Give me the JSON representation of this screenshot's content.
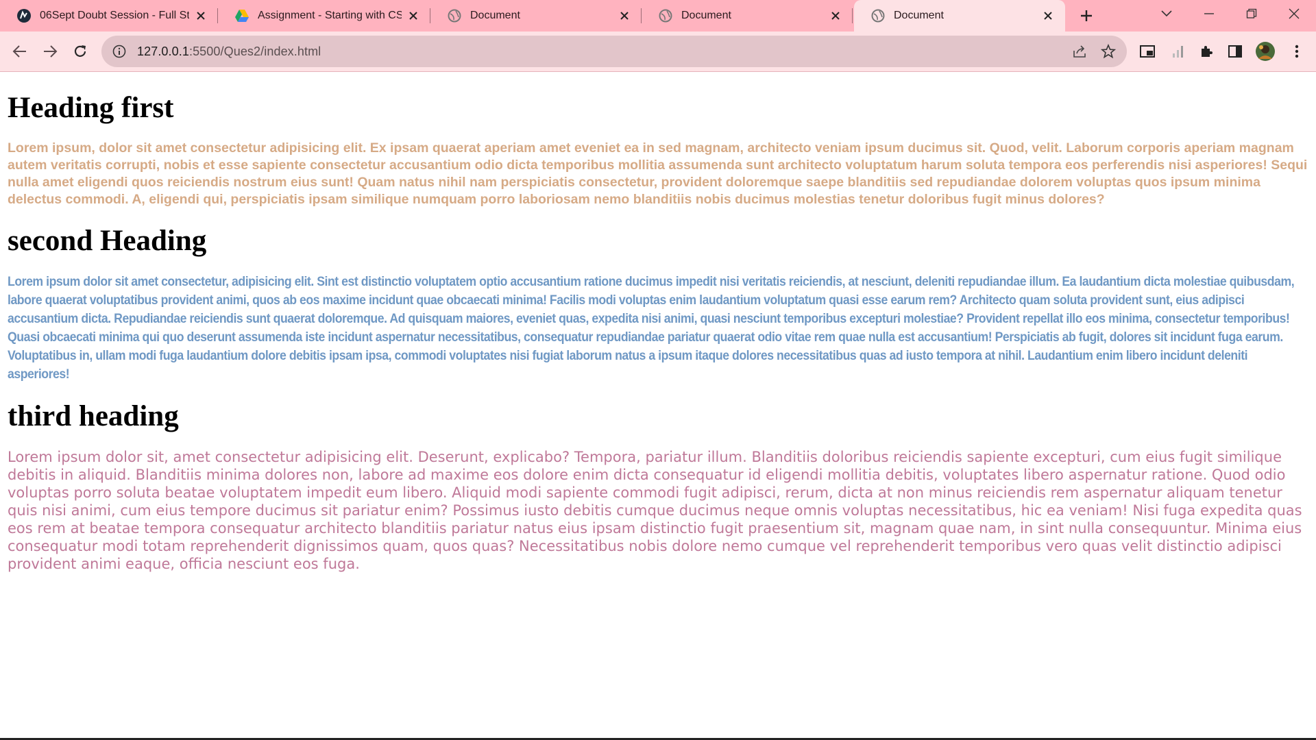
{
  "browser": {
    "tabs": [
      {
        "title": "06Sept Doubt Session - Full St",
        "favicon": "site-logo-icon",
        "active": false
      },
      {
        "title": "Assignment - Starting with CS",
        "favicon": "google-drive-icon",
        "active": false
      },
      {
        "title": "Document",
        "favicon": "globe-icon",
        "active": false
      },
      {
        "title": "Document",
        "favicon": "globe-icon",
        "active": false
      },
      {
        "title": "Document",
        "favicon": "globe-icon",
        "active": true
      }
    ],
    "address": {
      "host": "127.0.0.1",
      "path": ":5500/Ques2/index.html"
    },
    "colors": {
      "tabstrip": "#ffb3bf",
      "toolbar": "#fde2e5",
      "omnibox": "#e2c5ca"
    }
  },
  "page": {
    "sections": [
      {
        "heading": "Heading first",
        "paragraph": "Lorem ipsum, dolor sit amet consectetur adipisicing elit. Ex ipsam quaerat aperiam amet eveniet ea in sed magnam, architecto veniam ipsum ducimus sit. Quod, velit. Laborum corporis aperiam magnam autem veritatis corrupti, nobis et esse sapiente consectetur accusantium odio dicta temporibus mollitia assumenda sunt architecto voluptatum harum soluta tempora eos perferendis nisi asperiores! Sequi nulla amet eligendi quos reiciendis nostrum eius sunt! Quam natus nihil nam perspiciatis consectetur, provident doloremque saepe blanditiis sed repudiandae dolorem voluptas quos ipsum minima delectus commodi. A, eligendi qui, perspiciatis ipsam similique numquam porro laboriosam nemo blanditiis nobis ducimus molestias tenetur doloribus fugit minus dolores?",
        "color": "#d6aa86"
      },
      {
        "heading": "second Heading",
        "paragraph": "Lorem ipsum dolor sit amet consectetur, adipisicing elit. Sint est distinctio voluptatem optio accusantium ratione ducimus impedit nisi veritatis reiciendis, at nesciunt, deleniti repudiandae illum. Ea laudantium dicta molestiae quibusdam, labore quaerat voluptatibus provident animi, quos ab eos maxime incidunt quae obcaecati minima! Facilis modi voluptas enim laudantium voluptatum quasi esse earum rem? Architecto quam soluta provident sunt, eius adipisci accusantium dicta. Repudiandae reiciendis sunt quaerat doloremque. Ad quisquam maiores, eveniet quas, expedita nisi animi, quasi nesciunt temporibus excepturi molestiae? Provident repellat illo eos minima, consectetur temporibus! Quasi obcaecati minima qui quo deserunt assumenda iste incidunt aspernatur necessitatibus, consequatur repudiandae pariatur quaerat odio vitae rem quae nulla est accusantium! Perspiciatis ab fugit, dolores sit incidunt fuga earum. Voluptatibus in, ullam modi fuga laudantium dolore debitis ipsam ipsa, commodi voluptates nisi fugiat laborum natus a ipsum itaque dolores necessitatibus quas ad iusto tempora at nihil. Laudantium enim libero incidunt deleniti asperiores!",
        "color": "#6f98c4"
      },
      {
        "heading": "third heading",
        "paragraph": "Lorem ipsum dolor sit, amet consectetur adipisicing elit. Deserunt, explicabo? Tempora, pariatur illum. Blanditiis doloribus reiciendis sapiente excepturi, cum eius fugit similique debitis in aliquid. Blanditiis minima dolores non, labore ad maxime eos dolore enim dicta consequatur id eligendi mollitia debitis, voluptates libero aspernatur ratione. Quod odio voluptas porro soluta beatae voluptatem impedit eum libero. Aliquid modi sapiente commodi fugit adipisci, rerum, dicta at non minus reiciendis rem aspernatur aliquam tenetur quis nisi animi, cum eius tempore ducimus sit pariatur enim? Possimus iusto debitis cumque ducimus neque omnis voluptas necessitatibus, hic ea veniam! Nisi fuga expedita quas eos rem at beatae tempora consequatur architecto blanditiis pariatur natus eius ipsam distinctio fugit praesentium sit, magnam quae nam, in sint nulla consequuntur. Minima eius consequatur modi totam reprehenderit dignissimos quam, quos quas? Necessitatibus nobis dolore nemo cumque vel reprehenderit temporibus vero quas velit distinctio adipisci provident animi eaque, officia nesciunt eos fuga.",
        "color": "#bf7898"
      }
    ]
  }
}
